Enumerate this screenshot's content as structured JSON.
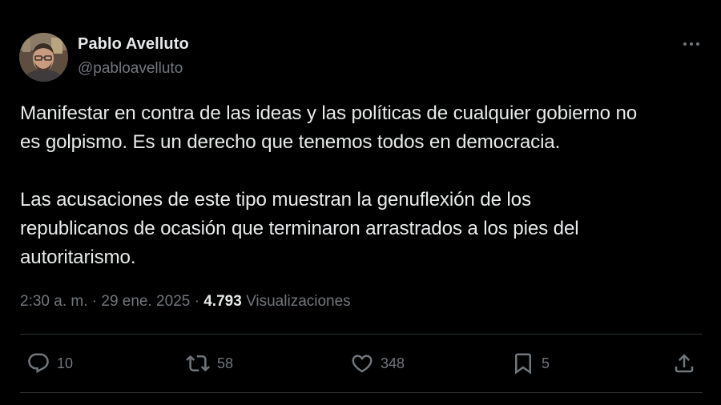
{
  "author": {
    "name": "Pablo Avelluto",
    "handle": "@pabloavelluto"
  },
  "tweet": {
    "text": "Manifestar en contra de las ideas y las políticas de cualquier gobierno no\nes golpismo. Es un derecho que tenemos todos en democracia.\n\nLas acusaciones de este tipo muestran la genuflexión de los\nrepublicanos de ocasión que terminaron arrastrados a los pies del\nautoritarismo."
  },
  "meta": {
    "time": "2:30 a. m.",
    "separator": "·",
    "date": "29 ene. 2025",
    "views_count": "4.793",
    "views_label": "Visualizaciones"
  },
  "actions": {
    "replies": "10",
    "reposts": "58",
    "likes": "348",
    "bookmarks": "5"
  },
  "icons": {
    "more": "more-dots-icon",
    "reply": "reply-bubble-icon",
    "repost": "repost-arrows-icon",
    "like": "heart-icon",
    "bookmark": "bookmark-icon",
    "share": "share-upload-icon"
  },
  "colors": {
    "background": "#000000",
    "text_primary": "#e7e9ea",
    "text_secondary": "#71767b",
    "divider": "#2f3336"
  }
}
